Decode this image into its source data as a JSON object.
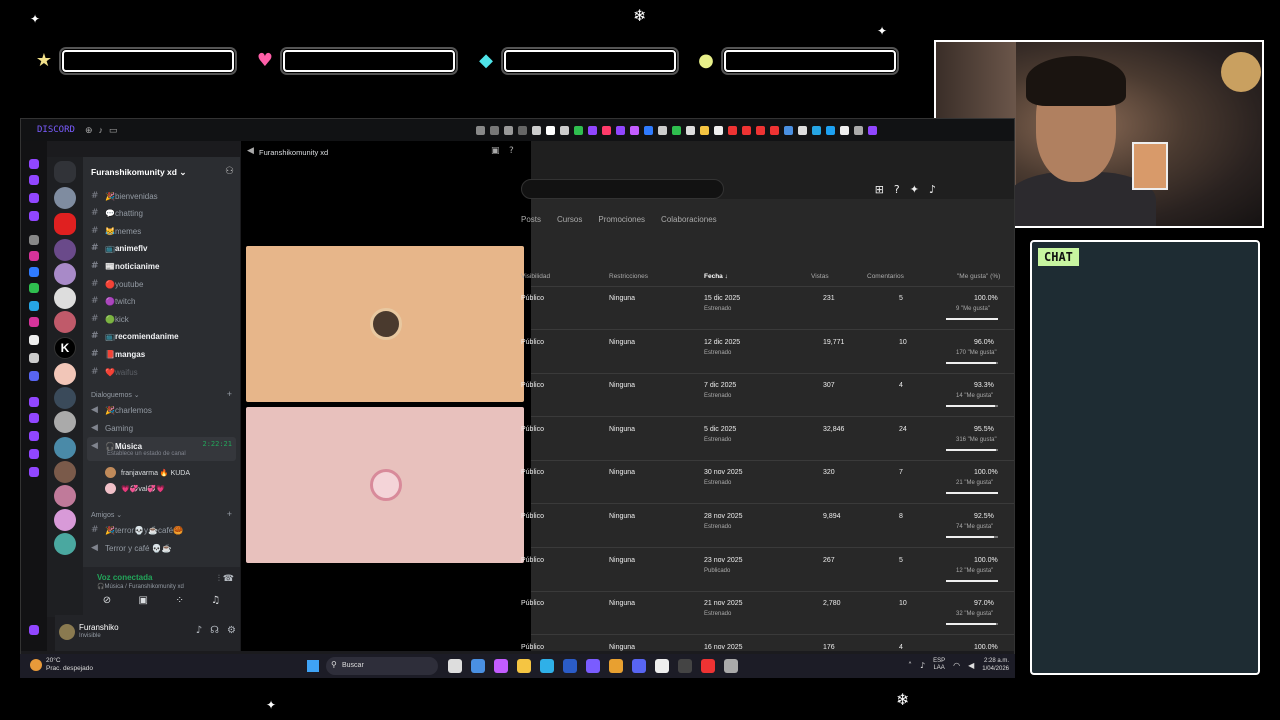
{
  "overlay": {
    "chat_label": "CHAT",
    "stat_icons": [
      "star",
      "heart",
      "diamond",
      "orb"
    ]
  },
  "discord": {
    "app_name": "DISCORD",
    "guild_name": "Furanshikomunity xd",
    "channels": [
      {
        "name": "🎉bienvenidas",
        "bold": false
      },
      {
        "name": "💬chatting",
        "bold": false
      },
      {
        "name": "😹memes",
        "bold": false
      },
      {
        "name": "📺animeflv",
        "bold": true
      },
      {
        "name": "📰noticianime",
        "bold": true
      },
      {
        "name": "🔴youtube",
        "bold": false
      },
      {
        "name": "🟣twitch",
        "bold": false
      },
      {
        "name": "🟢kick",
        "bold": false
      },
      {
        "name": "📺recomiendanime",
        "bold": true
      },
      {
        "name": "📕mangas",
        "bold": true
      },
      {
        "name": "❤️waifus",
        "bold": false
      }
    ],
    "category_dialogues": "Dialoguemos",
    "voice_channels": [
      "🎉charlemos",
      "Gaming"
    ],
    "active_vc": {
      "name": "🎧Música",
      "timer": "2:22:21",
      "status": "Establece un estado de canal"
    },
    "members": [
      "franjavarma 🔥 KUDA",
      "💗💞val💞💗"
    ],
    "category_friends": "Amigos",
    "friend_channels": [
      "🎉terror💀y☕café🥮",
      "Terror y café 💀☕"
    ],
    "voice_status": "Voz conectada",
    "voice_location": "🎧Música / Furanshikomunity xd",
    "user_name": "Furanshiko",
    "user_status": "Invisible",
    "stage_title": "Furanshikomunity xd"
  },
  "studio": {
    "tabs": [
      "Posts",
      "Cursos",
      "Promociones",
      "Colaboraciones"
    ],
    "headers": {
      "visibility": "Visibilidad",
      "restrictions": "Restricciones",
      "date": "Fecha ↓",
      "views": "Vistas",
      "comments": "Comentarios",
      "likes": "\"Me gusta\" (%)"
    },
    "rows": [
      {
        "vis": "Público",
        "res": "Ninguna",
        "date": "15 dic 2025",
        "state": "Estrenado",
        "views": "231",
        "comments": "5",
        "pct": "100.0%",
        "likes": "9 \"Me gusta\"",
        "ratio": 1.0
      },
      {
        "vis": "Público",
        "res": "Ninguna",
        "date": "12 dic 2025",
        "state": "Estrenado",
        "views": "19,771",
        "comments": "10",
        "pct": "96.0%",
        "likes": "170 \"Me gusta\"",
        "ratio": 0.96
      },
      {
        "vis": "Público",
        "res": "Ninguna",
        "date": "7 dic 2025",
        "state": "Estrenado",
        "views": "307",
        "comments": "4",
        "pct": "93.3%",
        "likes": "14 \"Me gusta\"",
        "ratio": 0.933
      },
      {
        "vis": "Público",
        "res": "Ninguna",
        "date": "5 dic 2025",
        "state": "Estrenado",
        "views": "32,846",
        "comments": "24",
        "pct": "95.5%",
        "likes": "316 \"Me gusta\"",
        "ratio": 0.955
      },
      {
        "vis": "Público",
        "res": "Ninguna",
        "date": "30 nov 2025",
        "state": "Estrenado",
        "views": "320",
        "comments": "7",
        "pct": "100.0%",
        "likes": "21 \"Me gusta\"",
        "ratio": 1.0
      },
      {
        "vis": "Público",
        "res": "Ninguna",
        "date": "28 nov 2025",
        "state": "Estrenado",
        "views": "9,894",
        "comments": "8",
        "pct": "92.5%",
        "likes": "74 \"Me gusta\"",
        "ratio": 0.925
      },
      {
        "vis": "Público",
        "res": "Ninguna",
        "date": "23 nov 2025",
        "state": "Publicado",
        "views": "267",
        "comments": "5",
        "pct": "100.0%",
        "likes": "12 \"Me gusta\"",
        "ratio": 1.0
      },
      {
        "vis": "Público",
        "res": "Ninguna",
        "date": "21 nov 2025",
        "state": "Estrenado",
        "views": "2,780",
        "comments": "10",
        "pct": "97.0%",
        "likes": "32 \"Me gusta\"",
        "ratio": 0.97
      },
      {
        "vis": "Público",
        "res": "Ninguna",
        "date": "16 nov 2025",
        "state": "",
        "views": "176",
        "comments": "4",
        "pct": "100.0%",
        "likes": "",
        "ratio": 1.0
      }
    ]
  },
  "taskbar": {
    "weather_temp": "20°C",
    "weather_desc": "Prac. despejado",
    "search_label": "Buscar",
    "lang_1": "ESP",
    "lang_2": "LAA",
    "time": "2:28 a.m.",
    "date": "1/04/2026"
  },
  "colors": {
    "accent": "#5865f2",
    "green": "#23a55a",
    "chat_bg": "#1e2c33"
  }
}
